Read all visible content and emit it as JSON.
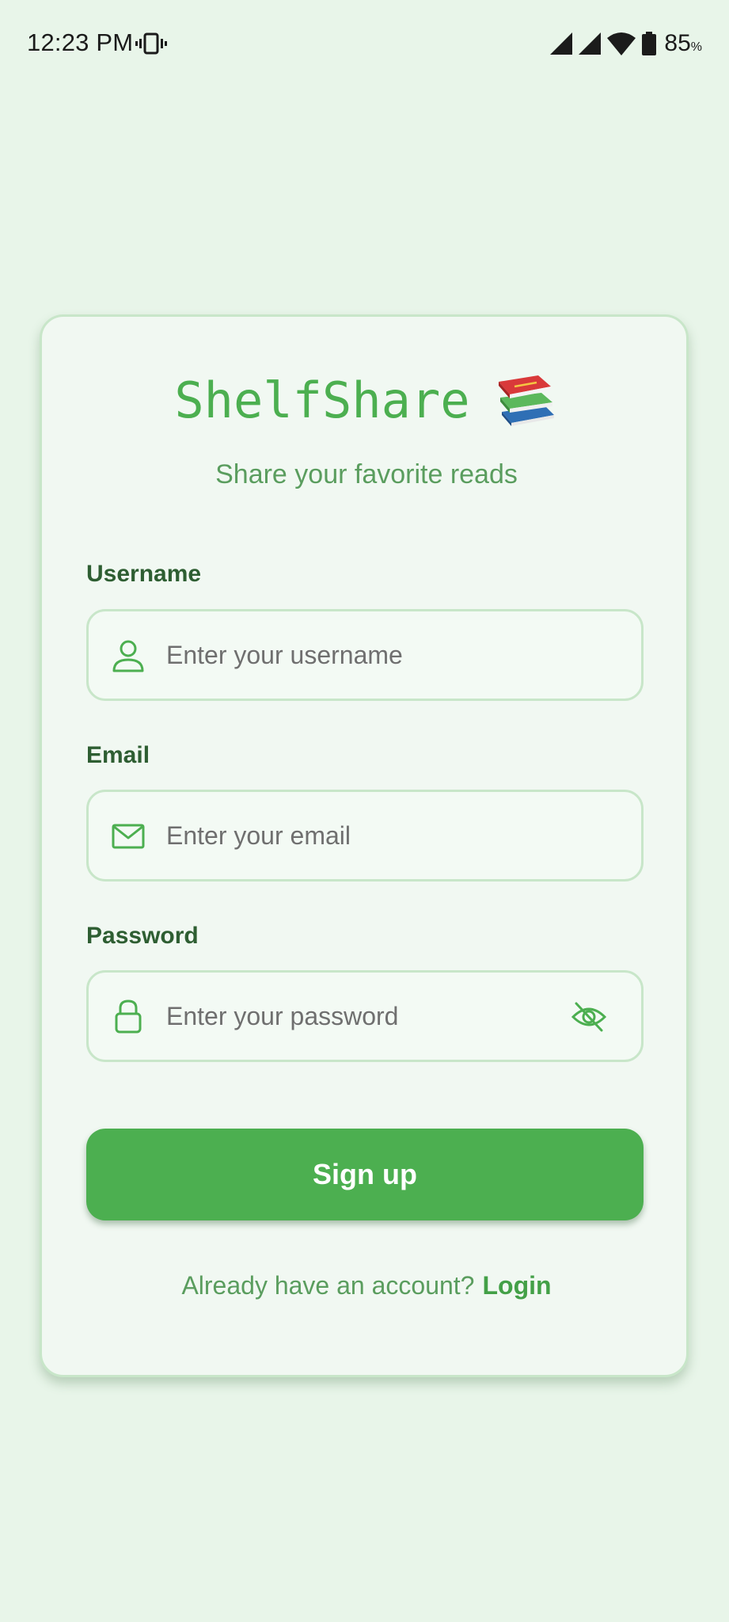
{
  "status_bar": {
    "time": "12:23 PM",
    "battery_percent": "85",
    "battery_unit": "%",
    "icons": [
      "vibrate-icon",
      "signal-icon",
      "signal-icon",
      "wifi-icon",
      "battery-icon"
    ]
  },
  "app": {
    "title": "ShelfShare",
    "title_icon": "books-icon",
    "subtitle": "Share your favorite reads"
  },
  "form": {
    "username": {
      "label": "Username",
      "placeholder": "Enter your username",
      "value": "",
      "icon": "person-icon"
    },
    "email": {
      "label": "Email",
      "placeholder": "Enter your email",
      "value": "",
      "icon": "mail-icon"
    },
    "password": {
      "label": "Password",
      "placeholder": "Enter your password",
      "value": "",
      "icon": "lock-icon",
      "toggle_icon": "eye-off-icon"
    },
    "submit_label": "Sign up"
  },
  "footer": {
    "prompt": "Already have an account?",
    "login_label": "Login"
  },
  "colors": {
    "background": "#e8f5e9",
    "card": "#f1f8f2",
    "accent": "#4caf50",
    "border": "#c8e6c9",
    "label": "#2e5e32",
    "subtitle": "#5a9d5e"
  }
}
